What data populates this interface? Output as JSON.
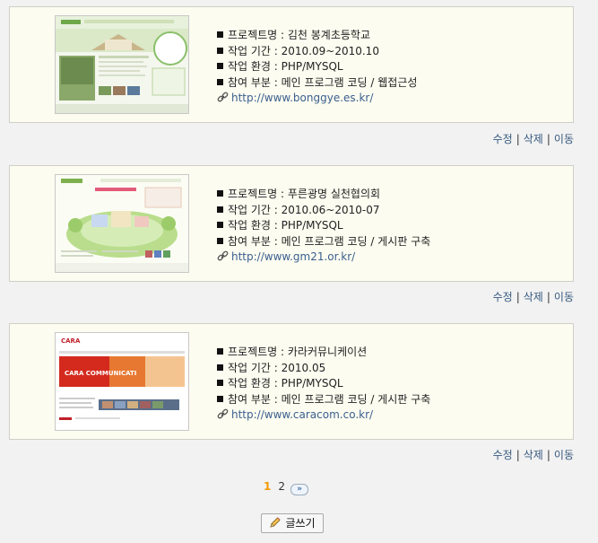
{
  "projects": [
    {
      "name": "프로젝트명 : 김천 봉계초등학교",
      "period": "작업 기간 : 2010.09~2010.10",
      "env": "작업 환경 : PHP/MYSQL",
      "part": "참여 부분 : 메인 프로그램 코딩 / 웹접근성",
      "url": "http://www.bonggye.es.kr/"
    },
    {
      "name": "프로젝트명 : 푸른광명 실천협의회",
      "period": "작업 기간 : 2010.06~2010-07",
      "env": "작업 환경 : PHP/MYSQL",
      "part": "참여 부분 : 메인 프로그램 코딩 / 게시판 구축",
      "url": "http://www.gm21.or.kr/"
    },
    {
      "name": "프로젝트명 : 카라커뮤니케이션",
      "period": "작업 기간 : 2010.05",
      "env": "작업 환경 : PHP/MYSQL",
      "part": "참여 부분 : 메인 프로그램 코딩 / 게시판 구축",
      "url": "http://www.caracom.co.kr/"
    }
  ],
  "actions": {
    "edit": "수정",
    "delete": "삭제",
    "move": "이동",
    "sep": "|"
  },
  "pagination": {
    "current": "1",
    "page2": "2",
    "next_symbol": "»"
  },
  "write_button": {
    "label": "글쓰기",
    "icon": "pencil-icon"
  },
  "thumb3_text": {
    "brand": "CARA",
    "banner": "CARA COMMUNICATI"
  }
}
